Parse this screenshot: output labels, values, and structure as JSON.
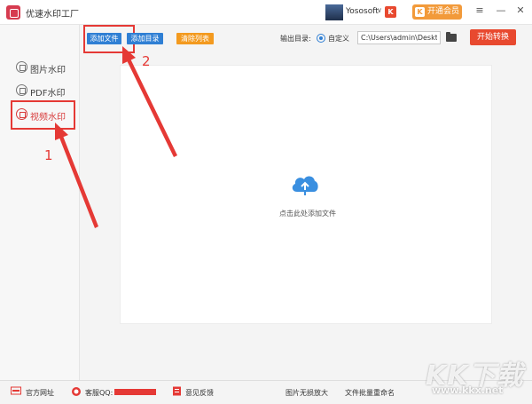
{
  "titlebar": {
    "app_title": "优速水印工厂",
    "username": "Yososoft",
    "chevron": "∨",
    "brand_badge": "K",
    "vip_label": "开通会员",
    "vip_icon": "K",
    "controls": [
      "≡",
      "—",
      "✕"
    ]
  },
  "sidebar": {
    "items": [
      {
        "label": "图片水印"
      },
      {
        "label": "PDF水印"
      },
      {
        "label": "视频水印"
      }
    ]
  },
  "toolbar": {
    "add_file": "添加文件",
    "add_folder": "添加目录",
    "clear_list": "清除列表",
    "output_label": "输出目录:",
    "radio_label": "自定义",
    "output_path": "C:\\Users\\admin\\Deskto",
    "start": "开始转换"
  },
  "dropzone": {
    "hint": "点击此处添加文件"
  },
  "annotations": [
    "1",
    "2"
  ],
  "footer": {
    "website": "官方网址",
    "service_qq": "客服QQ:",
    "feedback": "意见反馈",
    "image_upscale": "图片无损放大",
    "batch_rename": "文件批量重命名"
  },
  "watermark": {
    "text": "KK下载",
    "url": "www.kkx.net"
  },
  "colors": {
    "accent_red": "#e8492f",
    "toolbar_blue": "#2f7fd4",
    "clear_orange": "#f39a1f",
    "annotation_red": "#e53935",
    "cloud_blue": "#3a8fe0"
  }
}
